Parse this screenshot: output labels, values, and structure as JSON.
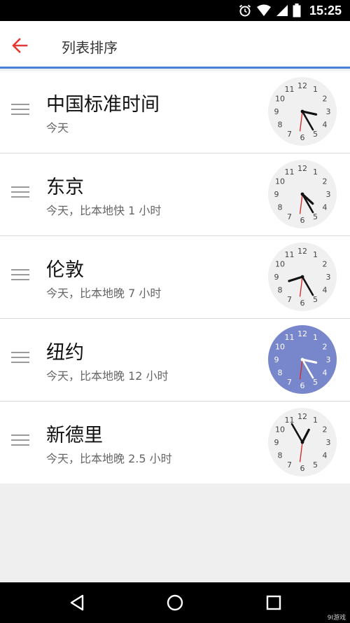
{
  "status_bar": {
    "time": "15:25",
    "icons": [
      "alarm-icon",
      "wifi-icon",
      "signal-icon",
      "battery-icon"
    ]
  },
  "app_bar": {
    "back_icon": "arrow-left-icon",
    "title": "列表排序",
    "accent_color": "#e53935",
    "divider_color": "#4a7fd6"
  },
  "clocks": [
    {
      "city": "中国标准时间",
      "subtitle": "今天",
      "time": "15:25",
      "highlighted": false
    },
    {
      "city": "东京",
      "subtitle": "今天，比本地快 1 小时",
      "time": "16:25",
      "highlighted": false
    },
    {
      "city": "伦敦",
      "subtitle": "今天，比本地晚 7 小时",
      "time": "08:25",
      "highlighted": false
    },
    {
      "city": "纽约",
      "subtitle": "今天，比本地晚 12 小时",
      "time": "03:25",
      "highlighted": true
    },
    {
      "city": "新德里",
      "subtitle": "今天，比本地晚 2.5 小时",
      "time": "12:55",
      "highlighted": false
    }
  ],
  "clock_style": {
    "face_color": "#f0f0f0",
    "highlight_face_color": "#7886cb",
    "second_hand_color": "#d32f2f",
    "numbers": [
      "12",
      "1",
      "2",
      "3",
      "4",
      "5",
      "6",
      "7",
      "8",
      "9",
      "10",
      "11"
    ]
  },
  "nav_bar": {
    "icons": [
      "back-triangle-icon",
      "home-circle-icon",
      "recents-square-icon"
    ]
  },
  "watermark": {
    "text": "9I游戏"
  }
}
